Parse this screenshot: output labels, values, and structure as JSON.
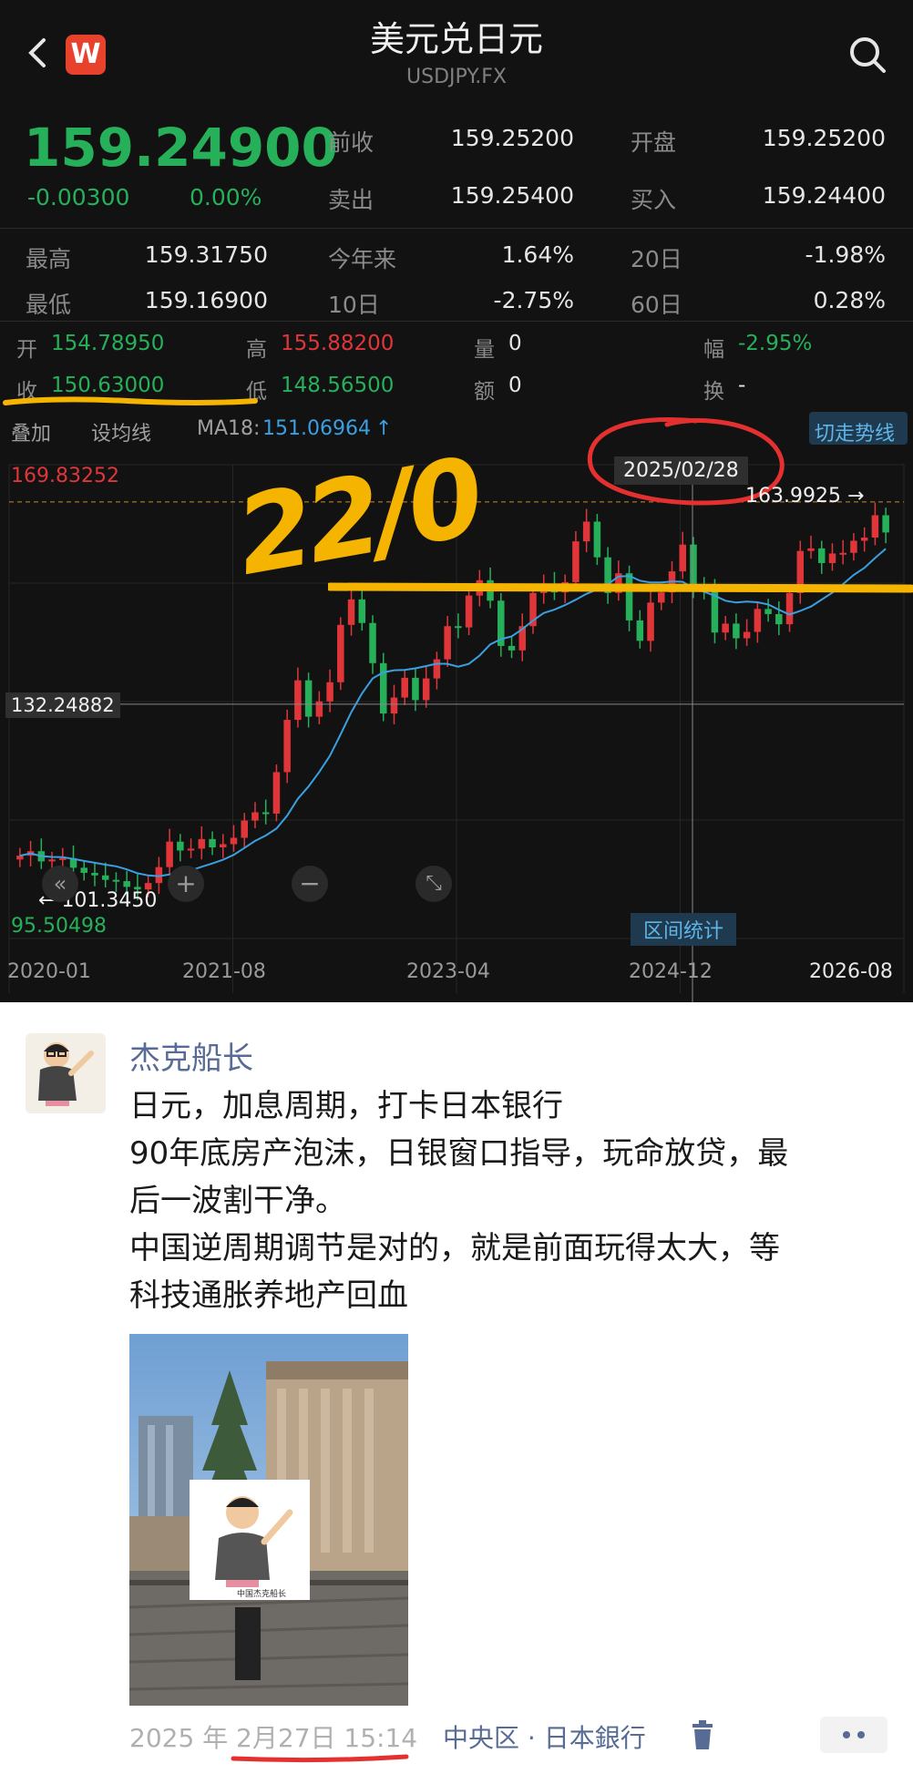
{
  "header": {
    "title": "美元兑日元",
    "subtitle": "USDJPY.FX",
    "back_icon": "chevron-left-icon",
    "app_icon_letter": "W",
    "search_icon": "search-icon"
  },
  "quote": {
    "price": "159.24900",
    "change": "-0.00300",
    "change_pct": "0.00%",
    "prev_close_label": "前收",
    "prev_close": "159.25200",
    "open_label": "开盘",
    "open": "159.25200",
    "sell_label": "卖出",
    "sell": "159.25400",
    "buy_label": "买入",
    "buy": "159.24400",
    "high_label": "最高",
    "high": "159.31750",
    "ytd_label": "今年来",
    "ytd": "1.64%",
    "d20_label": "20日",
    "d20": "-1.98%",
    "low_label": "最低",
    "low": "159.16900",
    "d10_label": "10日",
    "d10": "-2.75%",
    "d60_label": "60日",
    "d60": "0.28%"
  },
  "candle_info": {
    "open_label": "开",
    "open": "154.78950",
    "high_label": "高",
    "high": "155.88200",
    "vol_label": "量",
    "vol": "0",
    "amp_label": "幅",
    "amp": "-2.95%",
    "close_label": "收",
    "close": "150.63000",
    "low_label": "低",
    "low": "148.56500",
    "amt_label": "额",
    "amt": "0",
    "turnover_label": "换",
    "turnover": "-"
  },
  "toolbar": {
    "overlay": "叠加",
    "draw_line": "设均线",
    "ma_label": "MA18:",
    "ma_value": "151.06964",
    "ma_arrow": "↑",
    "switch_trend": "切走势线"
  },
  "chart_data": {
    "type": "candlestick",
    "x_tick_labels": [
      "2020-01",
      "2021-08",
      "2023-04",
      "2024-12",
      "2026-08"
    ],
    "y_max_label": "169.83252",
    "y_min_label": "95.50498",
    "crosshair_price": "132.24882",
    "crosshair_date": "2025/02/28",
    "max_marker": "163.9925",
    "min_marker": "101.3450",
    "period_stats": "区间统计",
    "handwritten_annotation": "22/0",
    "ylim": [
      95.50498,
      169.83252
    ],
    "closes": [
      108.5,
      109.2,
      107.6,
      107.9,
      108.1,
      106.6,
      105.8,
      105.4,
      104.7,
      104.5,
      103.6,
      103.2,
      104.2,
      106.7,
      110.7,
      109.3,
      109.6,
      111.1,
      109.8,
      110.3,
      111.3,
      114.0,
      115.3,
      115.1,
      121.6,
      129.8,
      136.0,
      130.3,
      132.7,
      135.7,
      144.7,
      148.7,
      145.0,
      138.7,
      130.8,
      133.3,
      136.4,
      132.9,
      136.3,
      139.3,
      144.5,
      144.3,
      149.3,
      151.7,
      148.5,
      141.4,
      140.7,
      144.5,
      149.7,
      151.0,
      149.8,
      151.4,
      157.8,
      160.9,
      155.3,
      149.7,
      152.8,
      145.4,
      142.2,
      148.2,
      149.8,
      153.1,
      157.3,
      150.6,
      149.9,
      143.5,
      144.9,
      142.6,
      143.6,
      147.2,
      146.4,
      144.8,
      149.7,
      156.3,
      156.7,
      154.4,
      155.9,
      156.0,
      157.9,
      158.4,
      161.9,
      159.2
    ]
  },
  "chart_controls": {
    "rewind_icon": "rewind-icon",
    "zoom_in_icon": "plus-icon",
    "zoom_out_icon": "minus-icon",
    "expand_icon": "expand-icon"
  },
  "post": {
    "author": "杰克船长",
    "lines": [
      "日元，加息周期，打卡日本银行",
      "90年底房产泡沫，日银窗口指导，玩命放贷，最",
      "后一波割干净。",
      "中国逆周期调节是对的，就是前面玩得太大，等",
      "科技通胀养地产回血"
    ],
    "photo_caption": "中国杰克船长",
    "time": "2025 年 2月27日 15:14",
    "location": "中央区 · 日本銀行",
    "delete_icon": "trash-icon",
    "more_icon": "more-icon"
  },
  "colors": {
    "up": "#e0363a",
    "down": "#26b05a",
    "ma_line": "#3aa0e0",
    "annotation": "#f4b400",
    "circle": "#e53030",
    "link": "#576b95"
  }
}
